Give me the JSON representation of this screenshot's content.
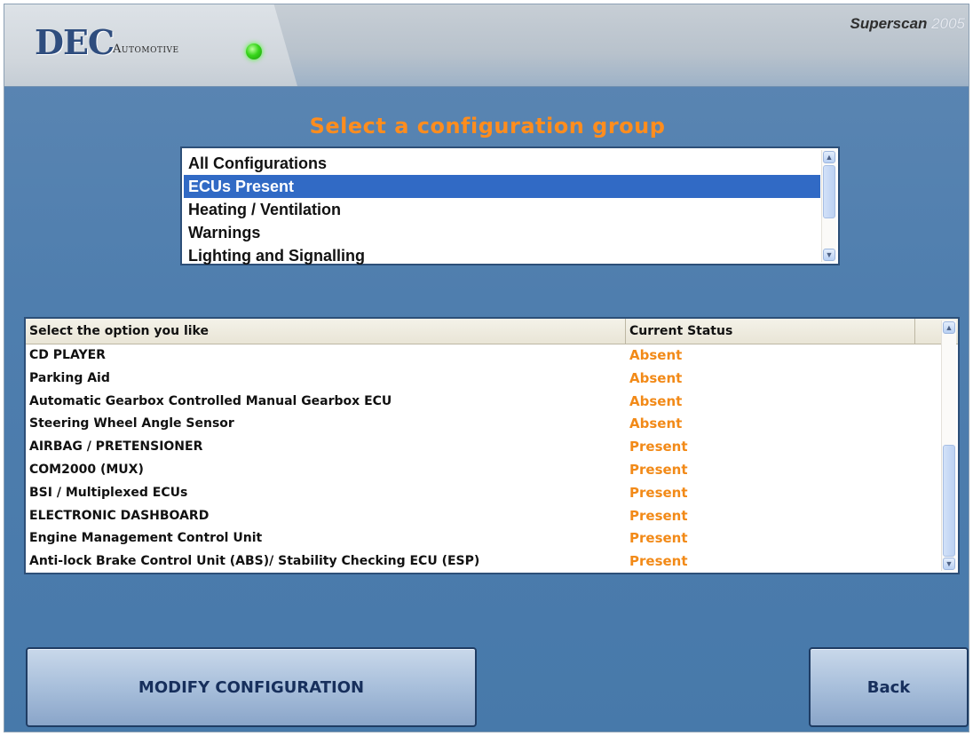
{
  "header": {
    "logo_main": "DEC",
    "logo_sub": "Automotive",
    "brand_name": "Superscan",
    "brand_year": "2005",
    "status_led_color": "#38d61b"
  },
  "title": "Select a configuration group",
  "groups": {
    "items": [
      "All Configurations",
      "ECUs Present",
      "Heating / Ventilation",
      "Warnings",
      "Lighting and Signalling"
    ],
    "selected": "ECUs Present"
  },
  "options_table": {
    "columns": [
      "Select the option you like",
      "Current Status"
    ],
    "rows": [
      {
        "name": "CD PLAYER",
        "status": "Absent"
      },
      {
        "name": "Parking Aid",
        "status": "Absent"
      },
      {
        "name": "Automatic Gearbox Controlled Manual Gearbox ECU",
        "status": "Absent"
      },
      {
        "name": "Steering Wheel Angle Sensor",
        "status": "Absent"
      },
      {
        "name": "AIRBAG / PRETENSIONER",
        "status": "Present"
      },
      {
        "name": "COM2000 (MUX)",
        "status": "Present"
      },
      {
        "name": "BSI / Multiplexed ECUs",
        "status": "Present"
      },
      {
        "name": "ELECTRONIC DASHBOARD",
        "status": "Present"
      },
      {
        "name": "Engine Management Control Unit",
        "status": "Present"
      },
      {
        "name": "Anti-lock Brake Control Unit  (ABS)/ Stability Checking ECU (ESP)",
        "status": "Present"
      }
    ]
  },
  "buttons": {
    "modify": "MODIFY CONFIGURATION",
    "back": "Back"
  },
  "colors": {
    "accent_orange": "#ff8d1e",
    "status_orange": "#f28a18",
    "selection_blue": "#316ac5",
    "background_blue": "#4f7eae"
  }
}
